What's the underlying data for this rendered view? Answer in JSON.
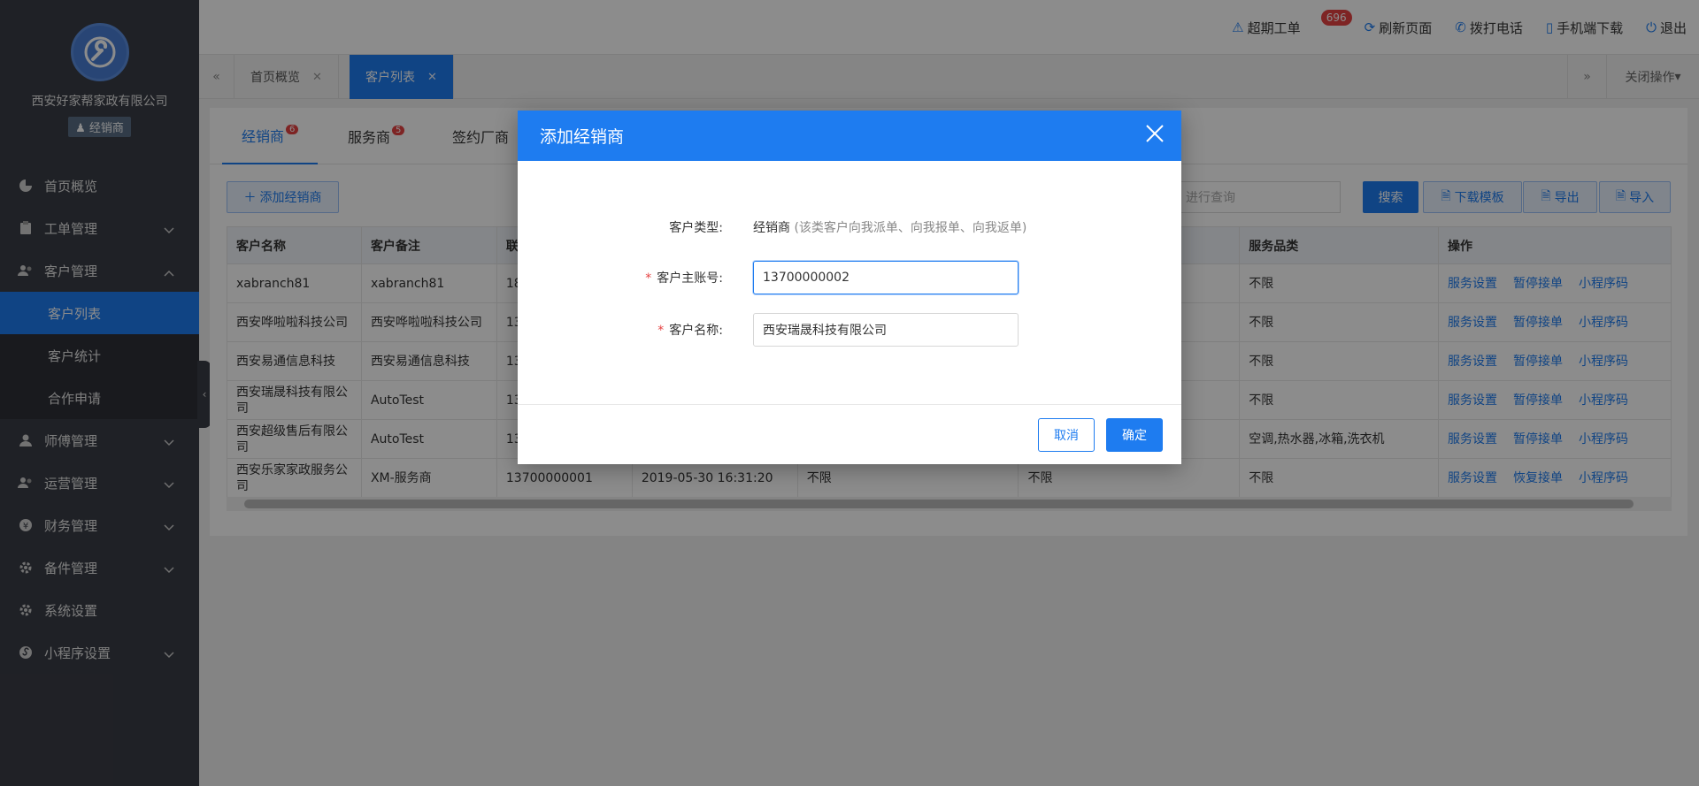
{
  "sidebar": {
    "company": "西安好家帮家政有限公司",
    "role": "经销商",
    "menu": [
      {
        "label": "首页概览"
      },
      {
        "label": "工单管理"
      },
      {
        "label": "客户管理"
      },
      {
        "label": "客户列表"
      },
      {
        "label": "客户统计"
      },
      {
        "label": "合作申请"
      },
      {
        "label": "师傅管理"
      },
      {
        "label": "运营管理"
      },
      {
        "label": "财务管理"
      },
      {
        "label": "备件管理"
      },
      {
        "label": "系统设置"
      },
      {
        "label": "小程序设置"
      }
    ]
  },
  "header": {
    "overdue_label": "超期工单",
    "overdue_count": "696",
    "refresh_label": "刷新页面",
    "call_label": "拨打电话",
    "mobile_label": "手机端下载",
    "logout_label": "退出"
  },
  "tabs": {
    "items": [
      {
        "label": "首页概览"
      },
      {
        "label": "客户列表"
      }
    ],
    "close_ops_label": "关闭操作"
  },
  "subtabs": [
    {
      "label": "经销商",
      "count": "6"
    },
    {
      "label": "服务商",
      "count": "5"
    },
    {
      "label": "签约厂商"
    }
  ],
  "toolbar": {
    "add_label": "添加经销商",
    "search_placeholder": "进行查询",
    "search_label": "搜索",
    "download_label": "下载模板",
    "export_label": "导出",
    "import_label": "导入"
  },
  "table": {
    "headers": [
      "客户名称",
      "客户备注",
      "联",
      "服务品类",
      "操作"
    ],
    "rows": [
      {
        "name": "xabranch81",
        "note": "xabranch81",
        "c3": "18",
        "c4": "",
        "c5": "",
        "c6": "",
        "category": "不限",
        "ops": [
          "服务设置",
          "暂停接单",
          "小程序码"
        ]
      },
      {
        "name": "西安哗啦啦科技公司",
        "note": "西安哗啦啦科技公司",
        "c3": "13",
        "c4": "",
        "c5": "",
        "c6": "",
        "category": "不限",
        "ops": [
          "服务设置",
          "暂停接单",
          "小程序码"
        ]
      },
      {
        "name": "西安易通信息科技",
        "note": "西安易通信息科技",
        "c3": "13",
        "c4": "",
        "c5": "",
        "c6": "",
        "category": "不限",
        "ops": [
          "服务设置",
          "暂停接单",
          "小程序码"
        ]
      },
      {
        "name": "西安瑞晟科技有限公司",
        "note": "AutoTest",
        "c3": "13",
        "c4": "",
        "c5": "",
        "c6": "",
        "category": "不限",
        "ops": [
          "服务设置",
          "暂停接单",
          "小程序码"
        ]
      },
      {
        "name": "西安超级售后有限公司",
        "note": "AutoTest",
        "c3": "13",
        "c4": "",
        "c5": "",
        "c6": "",
        "category": "空调,热水器,冰箱,洗衣机",
        "ops": [
          "服务设置",
          "暂停接单",
          "小程序码"
        ]
      },
      {
        "name": "西安乐家家政服务公司",
        "note": "XM-服务商",
        "c3": "13700000001",
        "c4": "2019-05-30 16:31:20",
        "c5": "不限",
        "c6": "不限",
        "category": "不限",
        "ops": [
          "服务设置",
          "恢复接单",
          "小程序码"
        ]
      }
    ]
  },
  "modal": {
    "title": "添加经销商",
    "type_label": "客户类型:",
    "type_value": "经销商",
    "type_hint": "(该类客户向我派单、向我报单、向我返单)",
    "account_label": "客户主账号:",
    "account_value": "13700000002",
    "name_label": "客户名称:",
    "name_value": "西安瑞晟科技有限公司",
    "cancel_label": "取消",
    "ok_label": "确定"
  }
}
